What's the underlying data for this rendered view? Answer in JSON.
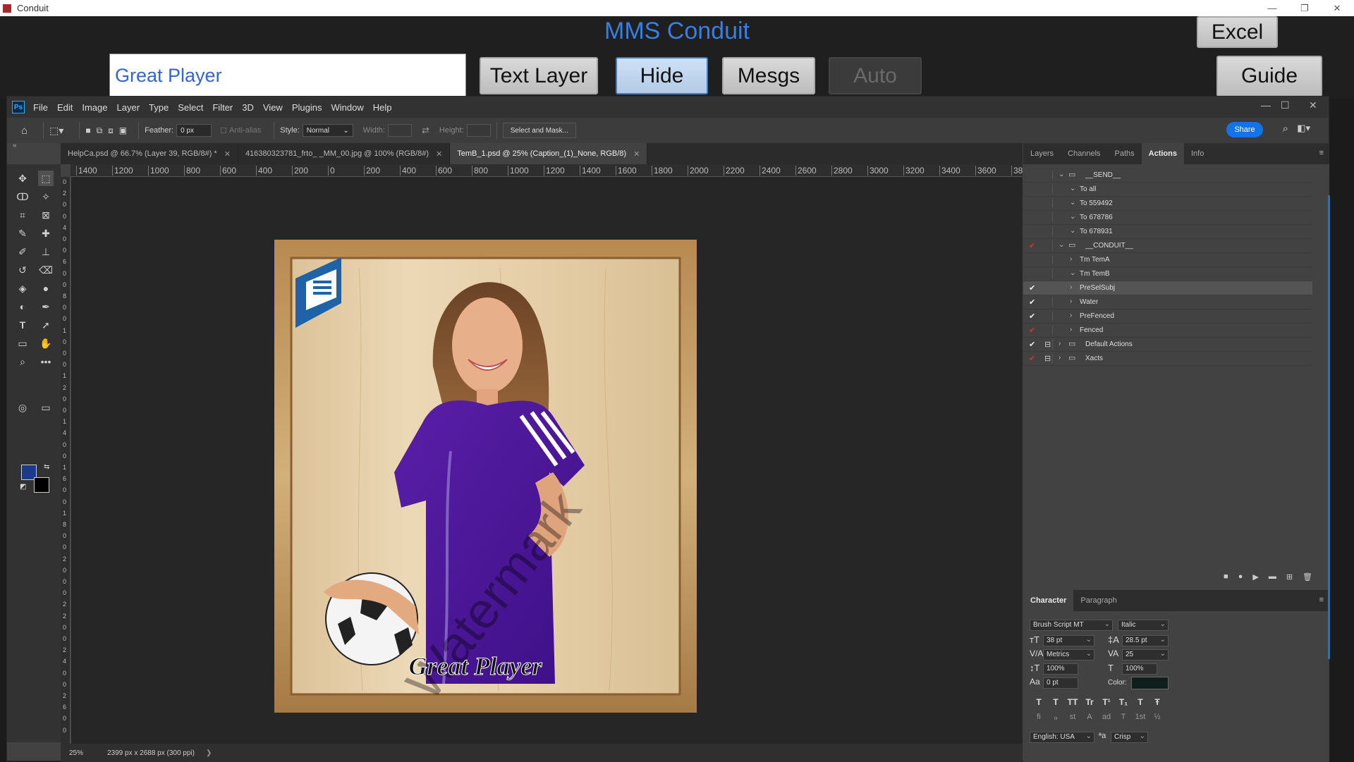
{
  "window": {
    "title": "Conduit"
  },
  "conduit": {
    "title": "MMS Conduit",
    "input_value": "Great Player",
    "buttons": {
      "text_layer": "Text Layer",
      "hide": "Hide",
      "mesgs": "Mesgs",
      "auto": "Auto",
      "excel": "Excel",
      "guide": "Guide"
    }
  },
  "photoshop": {
    "menus": [
      "File",
      "Edit",
      "Image",
      "Layer",
      "Type",
      "Select",
      "Filter",
      "3D",
      "View",
      "Plugins",
      "Window",
      "Help"
    ],
    "options": {
      "feather_label": "Feather:",
      "feather_value": "0 px",
      "antialias_label": "Anti-alias",
      "style_label": "Style:",
      "style_value": "Normal",
      "width_label": "Width:",
      "height_label": "Height:",
      "select_mask": "Select and Mask...",
      "share": "Share"
    },
    "tabs": [
      {
        "label": "HelpCa.psd @ 66.7% (Layer 39, RGB/8#) *"
      },
      {
        "label": "416380323781_frto_                               _MM_00.jpg @ 100% (RGB/8#)"
      },
      {
        "label": "TemB_1.psd @ 25% (Caption_(1)_None, RGB/8)"
      }
    ],
    "ruler_h": [
      "1400",
      "1200",
      "1000",
      "800",
      "600",
      "400",
      "200",
      "0",
      "200",
      "400",
      "600",
      "800",
      "1000",
      "1200",
      "1400",
      "1600",
      "1800",
      "2000",
      "2200",
      "2400",
      "2600",
      "2800",
      "3000",
      "3200",
      "3400",
      "3600",
      "38"
    ],
    "ruler_v": [
      "0",
      "2",
      "0",
      "0",
      "4",
      "0",
      "0",
      "6",
      "0",
      "0",
      "8",
      "0",
      "0",
      "1",
      "0",
      "0",
      "0",
      "1",
      "2",
      "0",
      "0",
      "1",
      "4",
      "0",
      "0",
      "1",
      "6",
      "0",
      "0",
      "1",
      "8",
      "0",
      "0",
      "2",
      "0",
      "0",
      "0",
      "2",
      "2",
      "0",
      "0",
      "2",
      "4",
      "0",
      "0",
      "2",
      "6",
      "0",
      "0"
    ],
    "status": {
      "zoom": "25%",
      "docsize": "2399 px x 2688 px (300 ppi)",
      "arrow": "❯"
    },
    "photo": {
      "caption": "Great Player",
      "watermark": "Watermark"
    }
  },
  "actions_panel": {
    "tabs": [
      "Layers",
      "Channels",
      "Paths",
      "Actions",
      "Info"
    ],
    "active_tab": "Actions",
    "rows": [
      {
        "check": "",
        "label": "__SEND__",
        "level": "set",
        "open": true
      },
      {
        "check": "",
        "label": "To all",
        "level": "action",
        "open": true
      },
      {
        "check": "",
        "label": "To 559492",
        "level": "action",
        "open": true
      },
      {
        "check": "",
        "label": "To 678786",
        "level": "action",
        "open": true
      },
      {
        "check": "",
        "label": "To 678931",
        "level": "action",
        "open": true
      },
      {
        "check": "red",
        "label": "__CONDUIT__",
        "level": "set",
        "open": true
      },
      {
        "check": "",
        "label": "Tm TemA",
        "level": "action",
        "open": false
      },
      {
        "check": "",
        "label": "Tm TemB",
        "level": "action",
        "open": true
      },
      {
        "check": "white",
        "label": "PreSelSubj",
        "level": "action",
        "open": false,
        "selected": true
      },
      {
        "check": "white",
        "label": "Water",
        "level": "action",
        "open": false
      },
      {
        "check": "white",
        "label": "PreFenced",
        "level": "action",
        "open": false
      },
      {
        "check": "red",
        "label": "Fenced",
        "level": "action",
        "open": false
      },
      {
        "check": "white",
        "label": "Default Actions",
        "level": "set",
        "open": false,
        "dialog": true
      },
      {
        "check": "red",
        "label": "Xacts",
        "level": "set",
        "open": false,
        "dialog": true
      }
    ]
  },
  "character_panel": {
    "tabs": [
      "Character",
      "Paragraph"
    ],
    "font": "Brush Script MT",
    "style": "Italic",
    "size": "38 pt",
    "leading": "28.5 pt",
    "kerning": "Metrics",
    "tracking": "25",
    "vscale": "100%",
    "hscale": "100%",
    "baseline": "0 pt",
    "color_label": "Color:",
    "color": "#0f1f1c",
    "type_styles": [
      "T",
      "T",
      "TT",
      "Tr",
      "T¹",
      "T₁",
      "T",
      "Ŧ"
    ],
    "opentype": [
      "fi",
      "ℴ",
      "st",
      "A",
      "ad",
      "T",
      "1st",
      "½"
    ],
    "language": "English: USA",
    "aa_label": "ªa",
    "antialias": "Crisp"
  }
}
